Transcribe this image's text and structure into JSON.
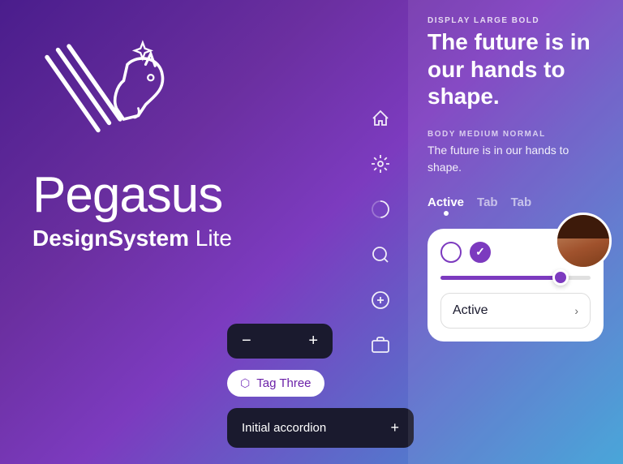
{
  "brand": {
    "name": "Pegasus",
    "subtitle_bold": "DesignSystem",
    "subtitle_light": " Lite"
  },
  "header": {
    "label_display": "DISPLAY LARGE BOLD",
    "heading": "The future is in our hands to shape.",
    "label_body": "BODY MEDIUM NORMAL",
    "body_text": "The future is in our hands to shape."
  },
  "tabs": [
    {
      "label": "Active",
      "active": true
    },
    {
      "label": "Tab",
      "active": false
    },
    {
      "label": "Tab",
      "active": false
    }
  ],
  "nav_icons": [
    {
      "name": "home-icon"
    },
    {
      "name": "settings-icon"
    },
    {
      "name": "loader-icon"
    },
    {
      "name": "search-icon"
    },
    {
      "name": "plus-icon"
    },
    {
      "name": "card-icon"
    }
  ],
  "stepper": {
    "minus_label": "−",
    "plus_label": "+"
  },
  "tag": {
    "label": "Tag Three",
    "icon": "🏷"
  },
  "accordion": {
    "label": "Initial accordion",
    "icon": "+"
  },
  "card": {
    "radio_options": [
      {
        "id": "r1",
        "checked": false
      },
      {
        "id": "r2",
        "checked": true
      }
    ],
    "slider_percent": 80,
    "dropdown_label": "Active",
    "dropdown_chevron": "›"
  }
}
